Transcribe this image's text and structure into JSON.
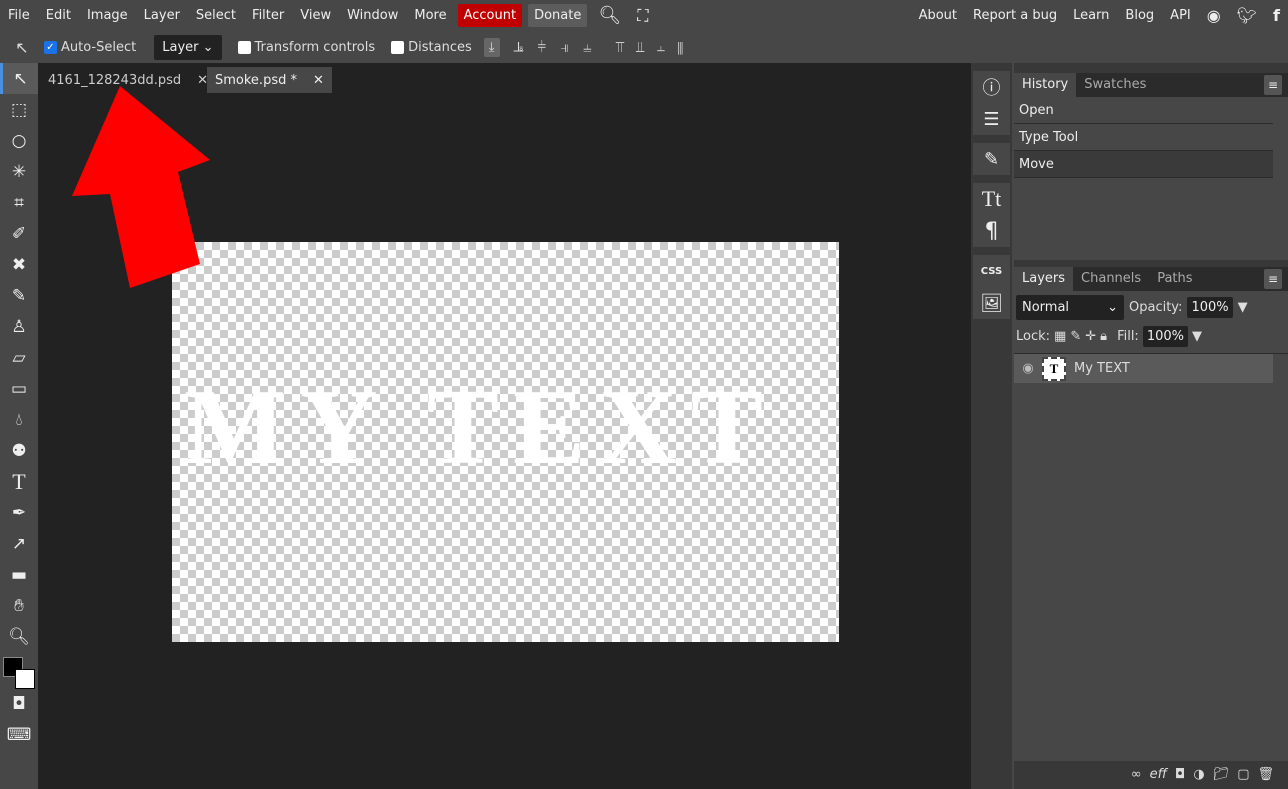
{
  "menu": {
    "items": [
      "File",
      "Edit",
      "Image",
      "Layer",
      "Select",
      "Filter",
      "View",
      "Window",
      "More"
    ],
    "account": "Account",
    "donate": "Donate",
    "right": [
      "About",
      "Report a bug",
      "Learn",
      "Blog",
      "API"
    ]
  },
  "colors": {
    "account": "#c00000",
    "accent": "#1a73e8",
    "arrow": "#ff0000"
  },
  "toolbar": {
    "auto_select": "Auto-Select",
    "auto_select_checked": true,
    "layer_select": "Layer",
    "transform_controls": "Transform controls",
    "distances": "Distances"
  },
  "tabs": [
    {
      "label": "4161_128243dd.psd"
    },
    {
      "label": "Smoke.psd *"
    }
  ],
  "canvas": {
    "text": "MY TEXT"
  },
  "history": {
    "tabs": [
      "History",
      "Swatches"
    ],
    "items": [
      "Open",
      "Type Tool",
      "Move"
    ]
  },
  "layers": {
    "tabs": [
      "Layers",
      "Channels",
      "Paths"
    ],
    "blend": "Normal",
    "opacity_label": "Opacity:",
    "opacity": "100%",
    "lock_label": "Lock:",
    "fill_label": "Fill:",
    "fill": "100%",
    "items": [
      {
        "name": "My TEXT",
        "thumb": "T"
      }
    ]
  },
  "strip": {
    "css": "CSS",
    "text_icon": "Tt"
  }
}
